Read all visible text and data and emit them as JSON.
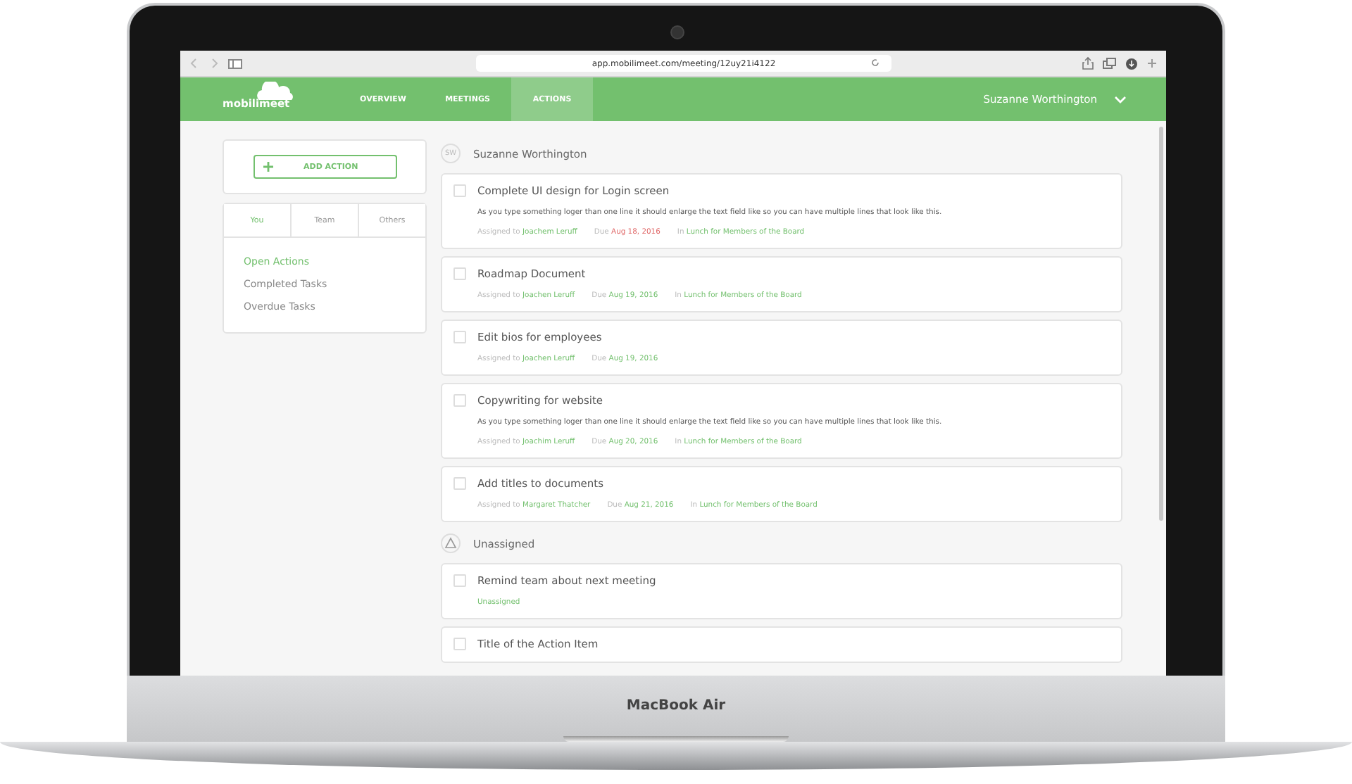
{
  "browser": {
    "url": "app.mobilimeet.com/meeting/12uy21i4122"
  },
  "nav": {
    "logo": "mobilimeet",
    "items": [
      {
        "label": "OVERVIEW",
        "selected": false
      },
      {
        "label": "MEETINGS",
        "selected": false
      },
      {
        "label": "ACTIONS",
        "selected": true
      }
    ],
    "user": "Suzanne Worthington"
  },
  "sidebar": {
    "add_button": "ADD ACTION",
    "tabs": [
      {
        "label": "You",
        "selected": true
      },
      {
        "label": "Team",
        "selected": false
      },
      {
        "label": "Others",
        "selected": false
      }
    ],
    "filters": [
      {
        "label": "Open Actions",
        "selected": true
      },
      {
        "label": "Completed Tasks",
        "selected": false
      },
      {
        "label": "Overdue Tasks",
        "selected": false
      }
    ]
  },
  "groups": [
    {
      "kind": "initials",
      "avatar": "SW",
      "name": "Suzanne Worthington",
      "actions": [
        {
          "title": "Complete UI design for Login screen",
          "checked": false,
          "description": "As you type something loger than one line it should enlarge the text field like so you can have multiple lines that look like this.",
          "assigned_label": "Assigned to",
          "assignee": "Joachem Leruff",
          "due_label": "Due",
          "due": "Aug 18, 2016",
          "overdue": true,
          "in_label": "In",
          "meeting": "Lunch for Members of the Board"
        },
        {
          "title": "Roadmap Document",
          "checked": false,
          "assigned_label": "Assigned to",
          "assignee": "Joachen Leruff",
          "due_label": "Due",
          "due": "Aug 19, 2016",
          "overdue": false,
          "in_label": "In",
          "meeting": "Lunch for Members of the Board"
        },
        {
          "title": "Edit bios for employees",
          "checked": false,
          "assigned_label": "Assigned to",
          "assignee": "Joachen Leruff",
          "due_label": "Due",
          "due": "Aug 19, 2016",
          "overdue": false
        },
        {
          "title": "Copywriting for website",
          "checked": false,
          "description": "As you type something loger than one line it should enlarge the text field like so you can have multiple lines that look like this.",
          "assigned_label": "Assigned to",
          "assignee": "Joachim Leruff",
          "due_label": "Due",
          "due": "Aug 20, 2016",
          "overdue": false,
          "in_label": "In",
          "meeting": "Lunch for Members of the Board"
        },
        {
          "title": "Add titles to documents",
          "checked": false,
          "assigned_label": "Assigned to",
          "assignee": "Margaret Thatcher",
          "due_label": "Due",
          "due": "Aug 21, 2016",
          "overdue": false,
          "in_label": "In",
          "meeting": "Lunch for Members of the Board"
        }
      ]
    },
    {
      "kind": "warning",
      "name": "Unassigned",
      "actions": [
        {
          "title": "Remind team about next meeting",
          "checked": false,
          "status": "Unassigned"
        },
        {
          "title": "Title of the Action Item",
          "checked": false
        }
      ]
    }
  ],
  "device": {
    "label": "MacBook Air"
  }
}
